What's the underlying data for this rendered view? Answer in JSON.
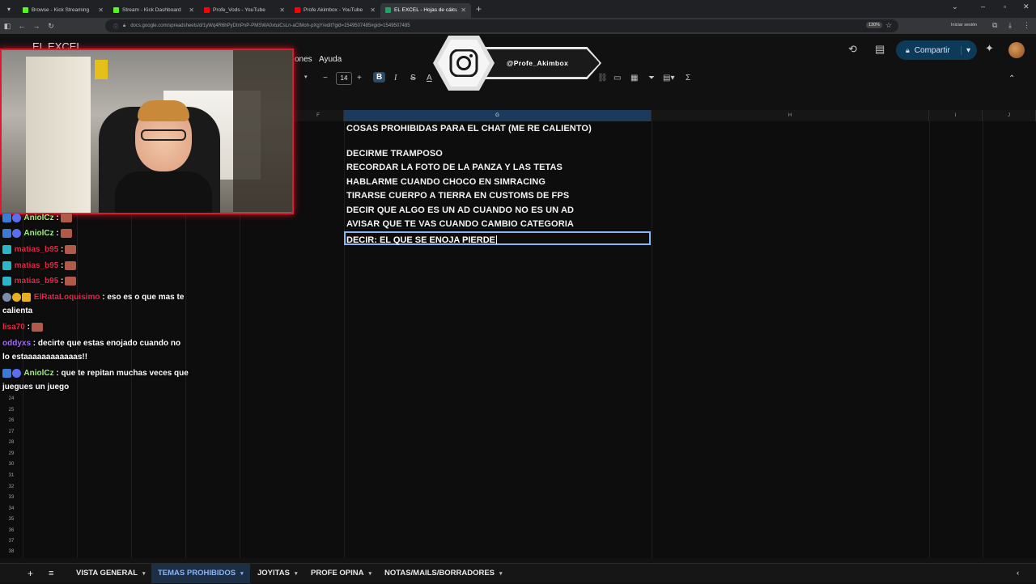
{
  "browser": {
    "tabs": [
      {
        "title": "Browse - Kick Streaming",
        "color": "#53fc18"
      },
      {
        "title": "Stream - Kick Dashboard",
        "color": "#53fc18"
      },
      {
        "title": "Profe_Vods - YouTube",
        "color": "#ff0000"
      },
      {
        "title": "Profe Akimbox - YouTube",
        "color": "#ff0000"
      },
      {
        "title": "EL EXCEL - Hojas de cálculo de",
        "color": "#1fa463"
      }
    ],
    "url": "docs.google.com/spreadsheets/d/1yWq4R6hPyDtnPnP-PMSWA0xtuiCsLn-aClMoh-pXgY/edit?gid=1549507485#gid=1549507485",
    "zoom": "130%",
    "signin": "Iniciar sesión"
  },
  "sheets": {
    "doc_title": "EL EXCEL",
    "menu": [
      "ones",
      "Ayuda"
    ],
    "share_label": "Compartir",
    "font_size": "14",
    "columns": [
      "F",
      "G",
      "H",
      "I",
      "J"
    ],
    "rows": [
      "24",
      "25",
      "26",
      "27",
      "28",
      "29",
      "30",
      "31",
      "32",
      "33",
      "34",
      "35",
      "36",
      "37",
      "38"
    ],
    "cells": [
      "COSAS PROHIBIDAS PARA EL CHAT (ME RE CALIENTO)",
      "DECIRME TRAMPOSO",
      "RECORDAR LA FOTO DE LA PANZA Y LAS TETAS",
      "HABLARME CUANDO CHOCO EN SIMRACING",
      "TIRARSE CUERPO A TIERRA EN CUSTOMS DE FPS",
      "DECIR QUE ALGO ES UN AD CUANDO NO ES UN AD",
      "AVISAR QUE TE VAS CUANDO CAMBIO CATEGORIA"
    ],
    "active_cell": "DECIR: EL QUE SE ENOJA PIERDE",
    "sheet_tabs": [
      "VISTA GENERAL",
      "TEMAS PROHIBIDOS",
      "JOYITAS",
      "PROFE OPINA",
      "NOTAS/MAILS/BORRADORES"
    ],
    "active_sheet": "TEMAS PROHIBIDOS"
  },
  "overlay": {
    "instagram_handle": "@Profe_Akimbox"
  },
  "chat": [
    {
      "user": "AniolCz",
      "color": "#a0f07a",
      "text": ":"
    },
    {
      "user": "AniolCz",
      "color": "#a0f07a",
      "text": ":"
    },
    {
      "user": "matias_b95",
      "color": "#e0284a",
      "text": ":"
    },
    {
      "user": "matias_b95",
      "color": "#e0284a",
      "text": ":"
    },
    {
      "user": "matias_b95",
      "color": "#e0284a",
      "text": ":"
    },
    {
      "user": "ElRataLoquisimo",
      "color": "#e0284a",
      "text": ": eso es o que mas te calienta"
    },
    {
      "user": "lisa70",
      "color": "#e0284a",
      "text": ":"
    },
    {
      "user": "oddyxs",
      "color": "#a06cf0",
      "text": ": decirte que estas enojado cuando no lo estaaaaaaaaaaaas!!"
    },
    {
      "user": "AniolCz",
      "color": "#a0f07a",
      "text": ": que te repitan muchas veces que juegues un juego"
    }
  ]
}
